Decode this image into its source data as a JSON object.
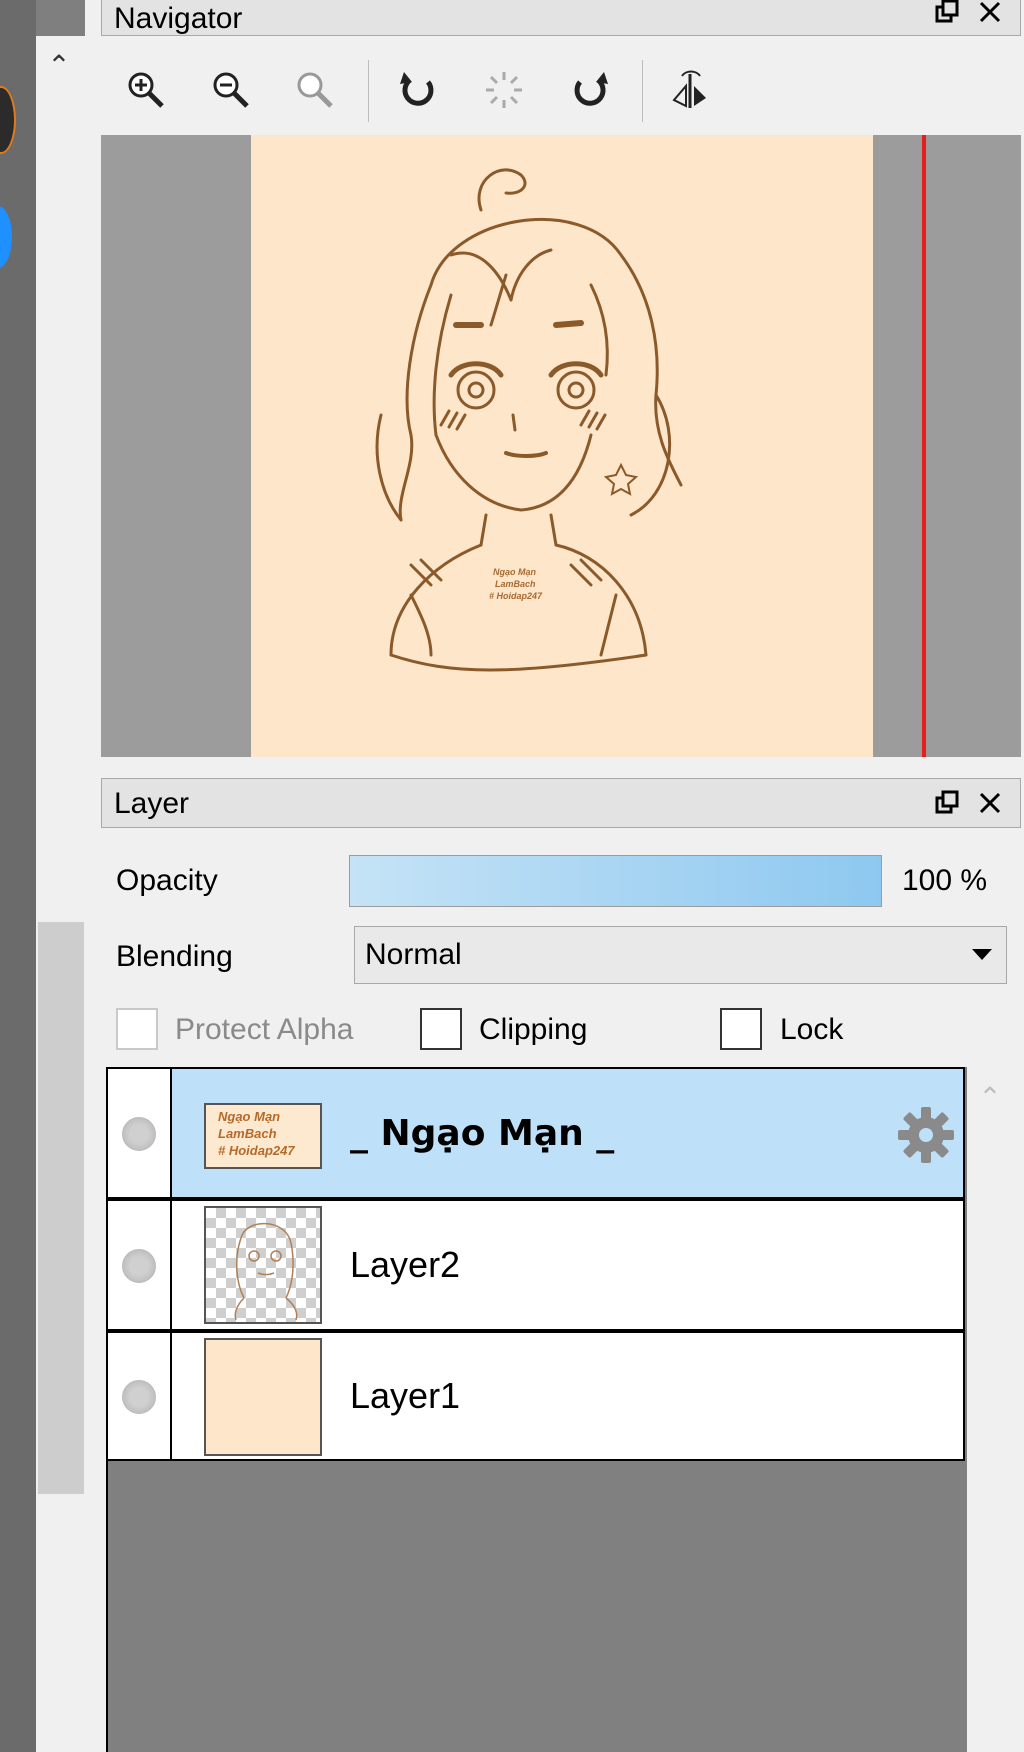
{
  "navigator": {
    "title": "Navigator",
    "tools": [
      "zoom-in-icon",
      "zoom-out-icon",
      "zoom-reset-icon",
      "rotate-left-icon",
      "rotate-reset-icon",
      "rotate-right-icon",
      "flip-horizontal-icon"
    ]
  },
  "layer_panel": {
    "title": "Layer",
    "opacity_label": "Opacity",
    "opacity_value": "100 %",
    "opacity_fraction": 1.0,
    "blending_label": "Blending",
    "blending_value": "Normal",
    "protect_alpha_label": "Protect Alpha",
    "clipping_label": "Clipping",
    "lock_label": "Lock",
    "layers": [
      {
        "name": "_ Ngạo Mạn _",
        "selected": true,
        "thumb_text": [
          "Ngạo Mạn",
          "LamBach",
          "# Hoidap247"
        ]
      },
      {
        "name": "Layer2",
        "selected": false
      },
      {
        "name": "Layer1",
        "selected": false
      }
    ]
  },
  "canvas_text": [
    "Ngạo Mạn",
    "LamBach",
    "# Hoidap247"
  ],
  "colors": {
    "accent_selected": "#bee0f9",
    "canvas": "#fee6cb",
    "sketch": "#8b5a2b",
    "view_line": "#e81e1e"
  }
}
